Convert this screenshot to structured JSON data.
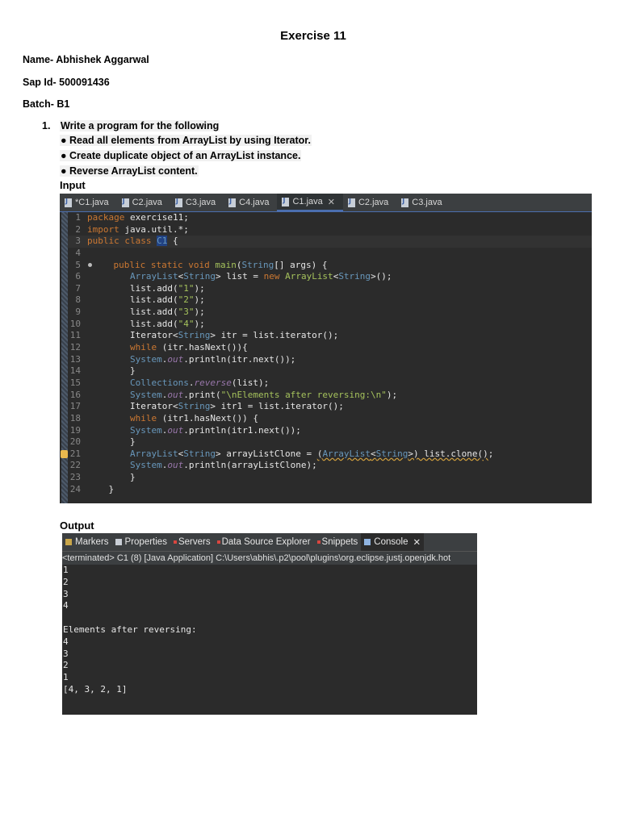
{
  "doc": {
    "title": "Exercise 11",
    "name": "Name- Abhishek Aggarwal",
    "sap": "Sap Id- 500091436",
    "batch": "Batch- B1",
    "question_number": "1.",
    "question_lines": [
      "Write a program for the following",
      "● Read all elements from ArrayList by using Iterator.",
      "● Create duplicate object of an ArrayList instance.",
      "● Reverse ArrayList content."
    ],
    "input_label": "Input",
    "output_label": "Output"
  },
  "editor": {
    "tabs": [
      "*C1.java",
      "C2.java",
      "C3.java",
      "C4.java",
      "C1.java",
      "C2.java",
      "C3.java"
    ],
    "active_tab_index": 4,
    "close_glyph": "✕",
    "line_numbers": [
      "1",
      "2",
      "3",
      "4",
      "5",
      "6",
      "7",
      "8",
      "9",
      "10",
      "11",
      "12",
      "13",
      "14",
      "15",
      "16",
      "17",
      "18",
      "19",
      "20",
      "21",
      "22",
      "23",
      "24"
    ]
  },
  "console": {
    "tabs": [
      "Markers",
      "Properties",
      "Servers",
      "Data Source Explorer",
      "Snippets",
      "Console"
    ],
    "close_glyph": "✕",
    "status": "<terminated> C1 (8) [Java Application] C:\\Users\\abhis\\.p2\\pool\\plugins\\org.eclipse.justj.openjdk.hot",
    "output": [
      "1",
      "2",
      "3",
      "4",
      "",
      "Elements after reversing:",
      "4",
      "3",
      "2",
      "1",
      "[4, 3, 2, 1]"
    ]
  },
  "colors": {
    "editor_bg": "#2b2b2b",
    "keyword": "#cc7832",
    "type": "#6897bb",
    "string": "#a5c25c",
    "field": "#9876aa"
  }
}
